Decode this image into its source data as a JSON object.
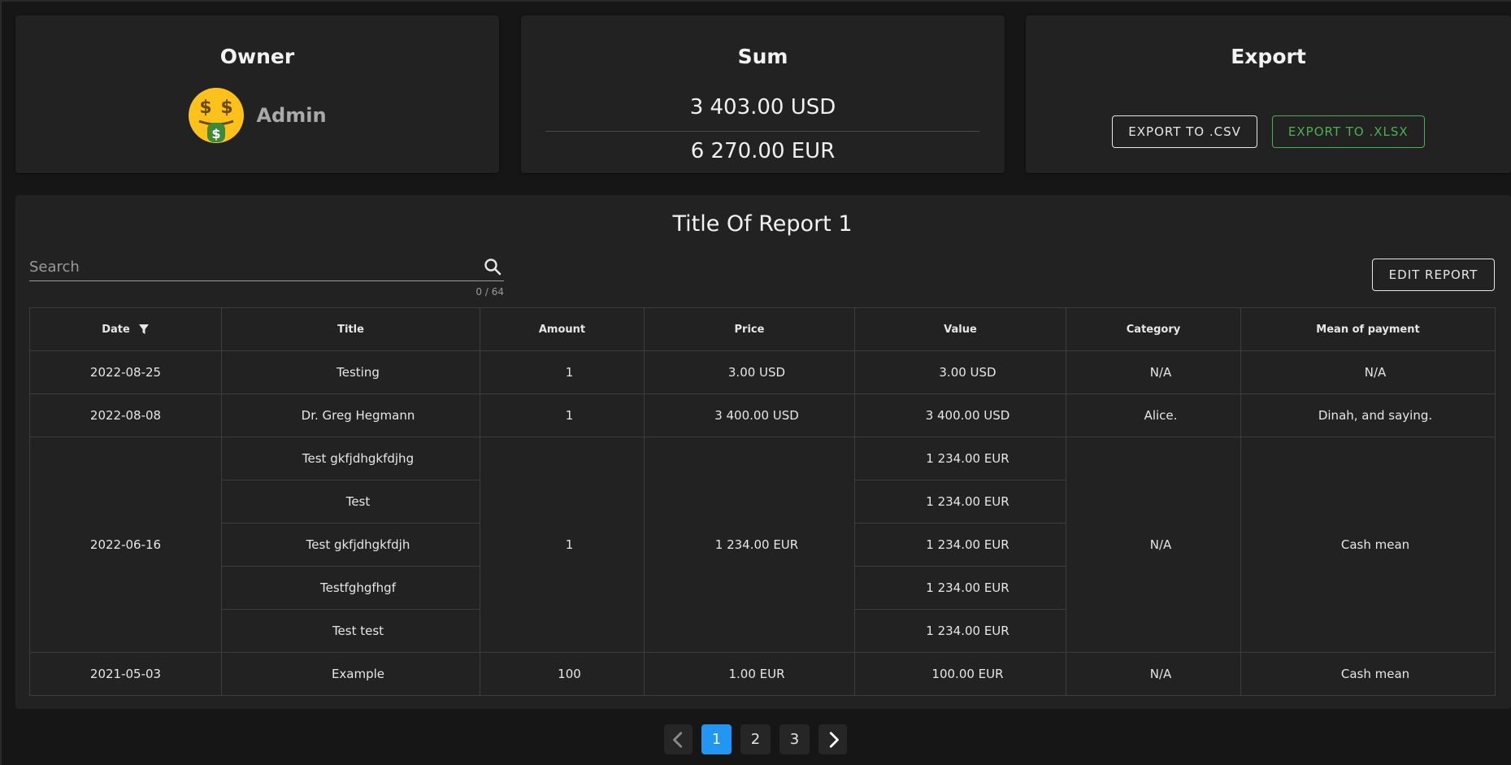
{
  "owner": {
    "title": "Owner",
    "name": "Admin",
    "avatar_icon": "money-mouth-face-icon"
  },
  "sum": {
    "title": "Sum",
    "usd": "3 403.00 USD",
    "eur": "6 270.00 EUR"
  },
  "export": {
    "title": "Export",
    "csv_label": "EXPORT TO .CSV",
    "xlsx_label": "EXPORT TO .XLSX",
    "xlsx_color": "#4caf50"
  },
  "report": {
    "title": "Title Of Report 1",
    "search_placeholder": "Search",
    "search_counter": "0 / 64",
    "edit_label": "EDIT REPORT",
    "columns": [
      "Date",
      "Title",
      "Amount",
      "Price",
      "Value",
      "Category",
      "Mean of payment"
    ],
    "rows": [
      {
        "date": "2022-08-25",
        "title": "Testing",
        "amount": "1",
        "price": "3.00 USD",
        "value": "3.00 USD",
        "category": "N/A",
        "payment": "N/A"
      },
      {
        "date": "2022-08-08",
        "title": "Dr. Greg Hegmann",
        "amount": "1",
        "price": "3 400.00 USD",
        "value": "3 400.00 USD",
        "category": "Alice.",
        "payment": "Dinah, and saying."
      },
      {
        "date": "2022-06-16",
        "amount": "1",
        "price": "1 234.00 EUR",
        "category": "N/A",
        "payment": "Cash mean",
        "items": [
          {
            "title": "Test gkfjdhgkfdjhg",
            "value": "1 234.00 EUR"
          },
          {
            "title": "Test",
            "value": "1 234.00 EUR"
          },
          {
            "title": "Test gkfjdhgkfdjh",
            "value": "1 234.00 EUR"
          },
          {
            "title": "Testfghgfhgf",
            "value": "1 234.00 EUR"
          },
          {
            "title": "Test test",
            "value": "1 234.00 EUR"
          }
        ]
      },
      {
        "date": "2021-05-03",
        "title": "Example",
        "amount": "100",
        "price": "1.00 EUR",
        "value": "100.00 EUR",
        "category": "N/A",
        "payment": "Cash mean"
      }
    ]
  },
  "pagination": {
    "pages": [
      "1",
      "2",
      "3"
    ],
    "active": "1",
    "accent": "#2196f3"
  }
}
